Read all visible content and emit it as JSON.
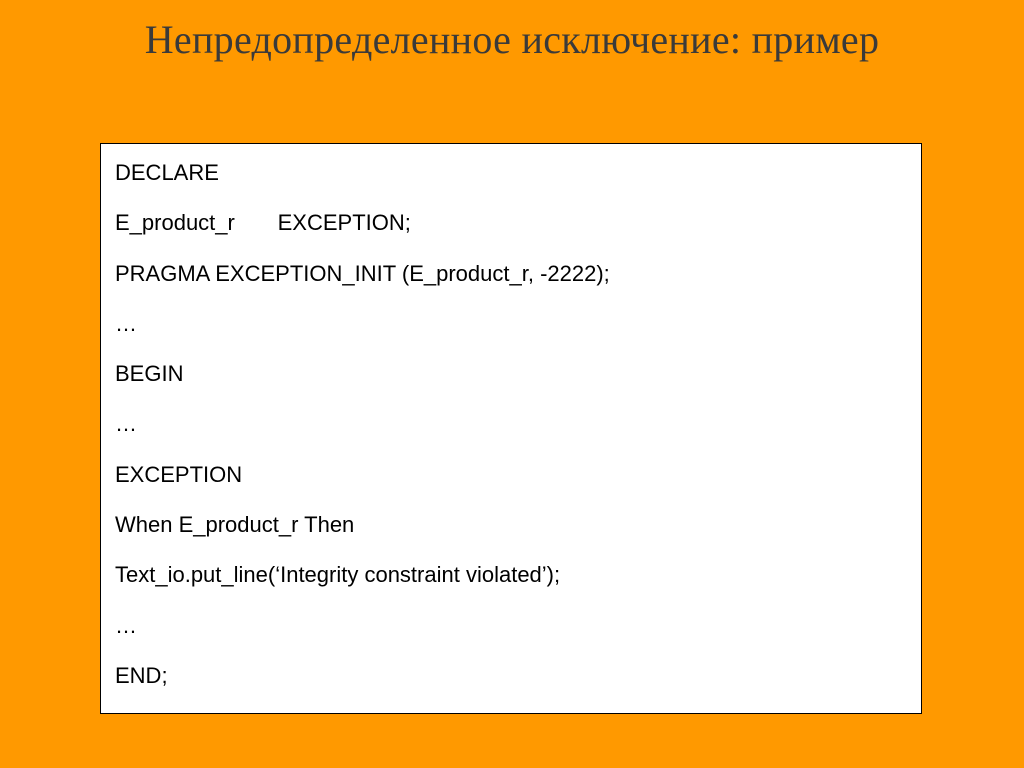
{
  "title": "Непредопределенное исключение: пример",
  "code": [
    "DECLARE",
    "E_product_r       EXCEPTION;",
    "PRAGMA EXCEPTION_INIT (E_product_r, -2222);",
    "…",
    "BEGIN",
    "…",
    "EXCEPTION",
    "When E_product_r Then",
    "Text_io.put_line(‘Integrity constraint violated’);",
    "…",
    "END;"
  ]
}
